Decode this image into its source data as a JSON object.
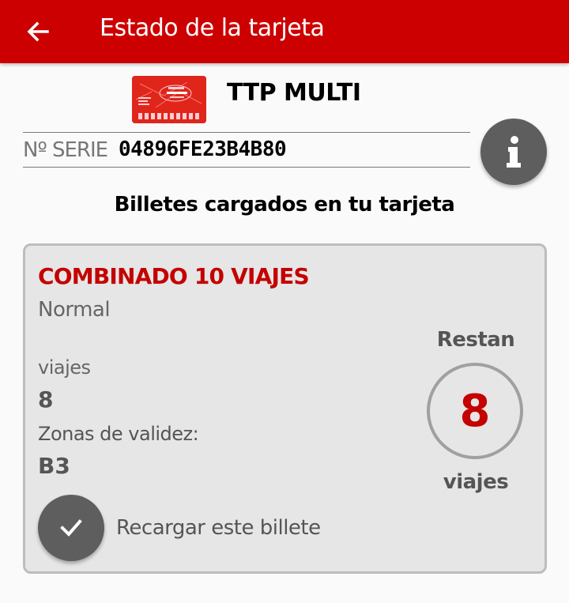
{
  "appbar": {
    "title": "Estado de la tarjeta",
    "back_icon": "arrow-left-icon",
    "color": "#cc0000"
  },
  "card": {
    "name": "TTP MULTI",
    "image_icon": "transport-card-icon",
    "serial_label": "Nº SERIE",
    "serial_number": "04896FE23B4B80",
    "info_icon": "info-icon"
  },
  "section_heading": "Billetes cargados en tu tarjeta",
  "ticket": {
    "name": "COMBINADO 10 VIAJES",
    "type": "Normal",
    "trips_label": "viajes",
    "trips_value": "8",
    "zones_label": "Zonas de validez:",
    "zones_value": "B3",
    "remaining_title": "Restan",
    "remaining_count": "8",
    "remaining_unit": "viajes",
    "reload_label": "Recargar este billete",
    "reload_icon": "check-icon",
    "accent_color": "#c40000"
  }
}
